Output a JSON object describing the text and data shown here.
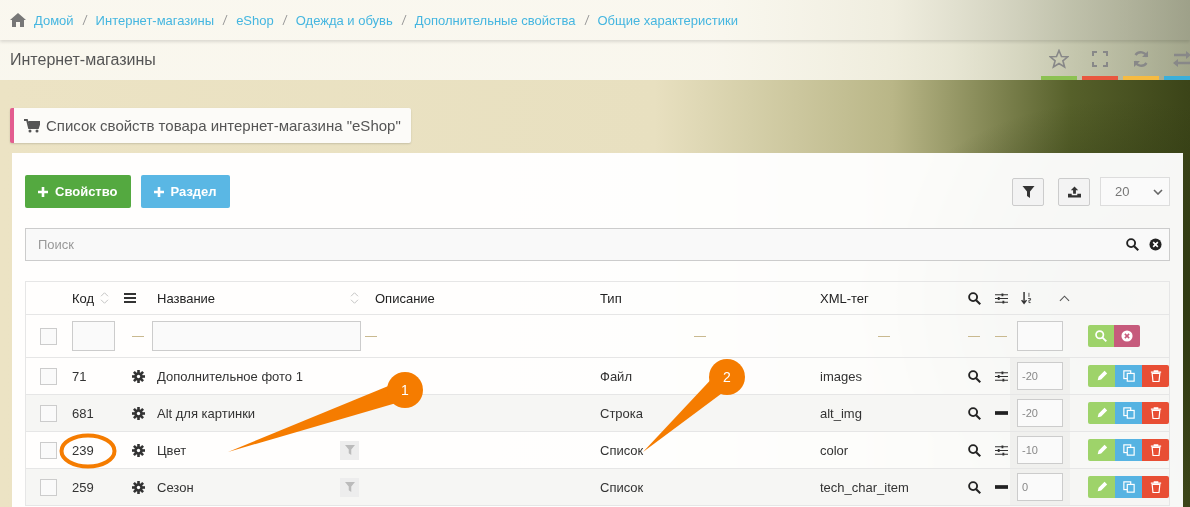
{
  "breadcrumbs": [
    "Домой",
    "Интернет-магазины",
    "eShop",
    "Одежда и обувь",
    "Дополнительные свойства",
    "Общие характеристики"
  ],
  "page_title": "Интернет-магазины",
  "header_actions": [
    {
      "kind": "star",
      "color": "#8cc152"
    },
    {
      "kind": "expand",
      "color": "#e9573f"
    },
    {
      "kind": "refresh",
      "color": "#f6bb42"
    },
    {
      "kind": "exchange",
      "color": "#3bafda"
    }
  ],
  "panel_title": "Список свойств товара интернет-магазина \"eShop\"",
  "toolbar": {
    "buttons": [
      {
        "label": "Свойство",
        "kind": "success"
      },
      {
        "label": "Раздел",
        "kind": "info"
      }
    ],
    "page_size": "20"
  },
  "search": {
    "placeholder": "Поиск"
  },
  "table": {
    "filter_row": {
      "checked": false
    },
    "columns": [
      "Код",
      "Название",
      "Описание",
      "Тип",
      "XML-тег"
    ],
    "rows": [
      {
        "checked": false,
        "code": "71",
        "name": "Дополнительное фото 1",
        "filter": false,
        "type": "Файл",
        "xml_tag": "images",
        "kind": "sliders",
        "sorting": "-20",
        "circled": false
      },
      {
        "checked": false,
        "code": "681",
        "name": "Alt для картинки",
        "filter": false,
        "type": "Строка",
        "xml_tag": "alt_img",
        "kind": "dash",
        "sorting": "-20",
        "circled": false
      },
      {
        "checked": false,
        "code": "239",
        "name": "Цвет",
        "filter": true,
        "type": "Список",
        "xml_tag": "color",
        "kind": "sliders",
        "sorting": "-10",
        "circled": true
      },
      {
        "checked": false,
        "code": "259",
        "name": "Сезон",
        "filter": true,
        "type": "Список",
        "xml_tag": "tech_char_item",
        "kind": "dash",
        "sorting": "0",
        "circled": false
      }
    ]
  },
  "callouts": [
    {
      "label": "1"
    },
    {
      "label": "2"
    }
  ]
}
